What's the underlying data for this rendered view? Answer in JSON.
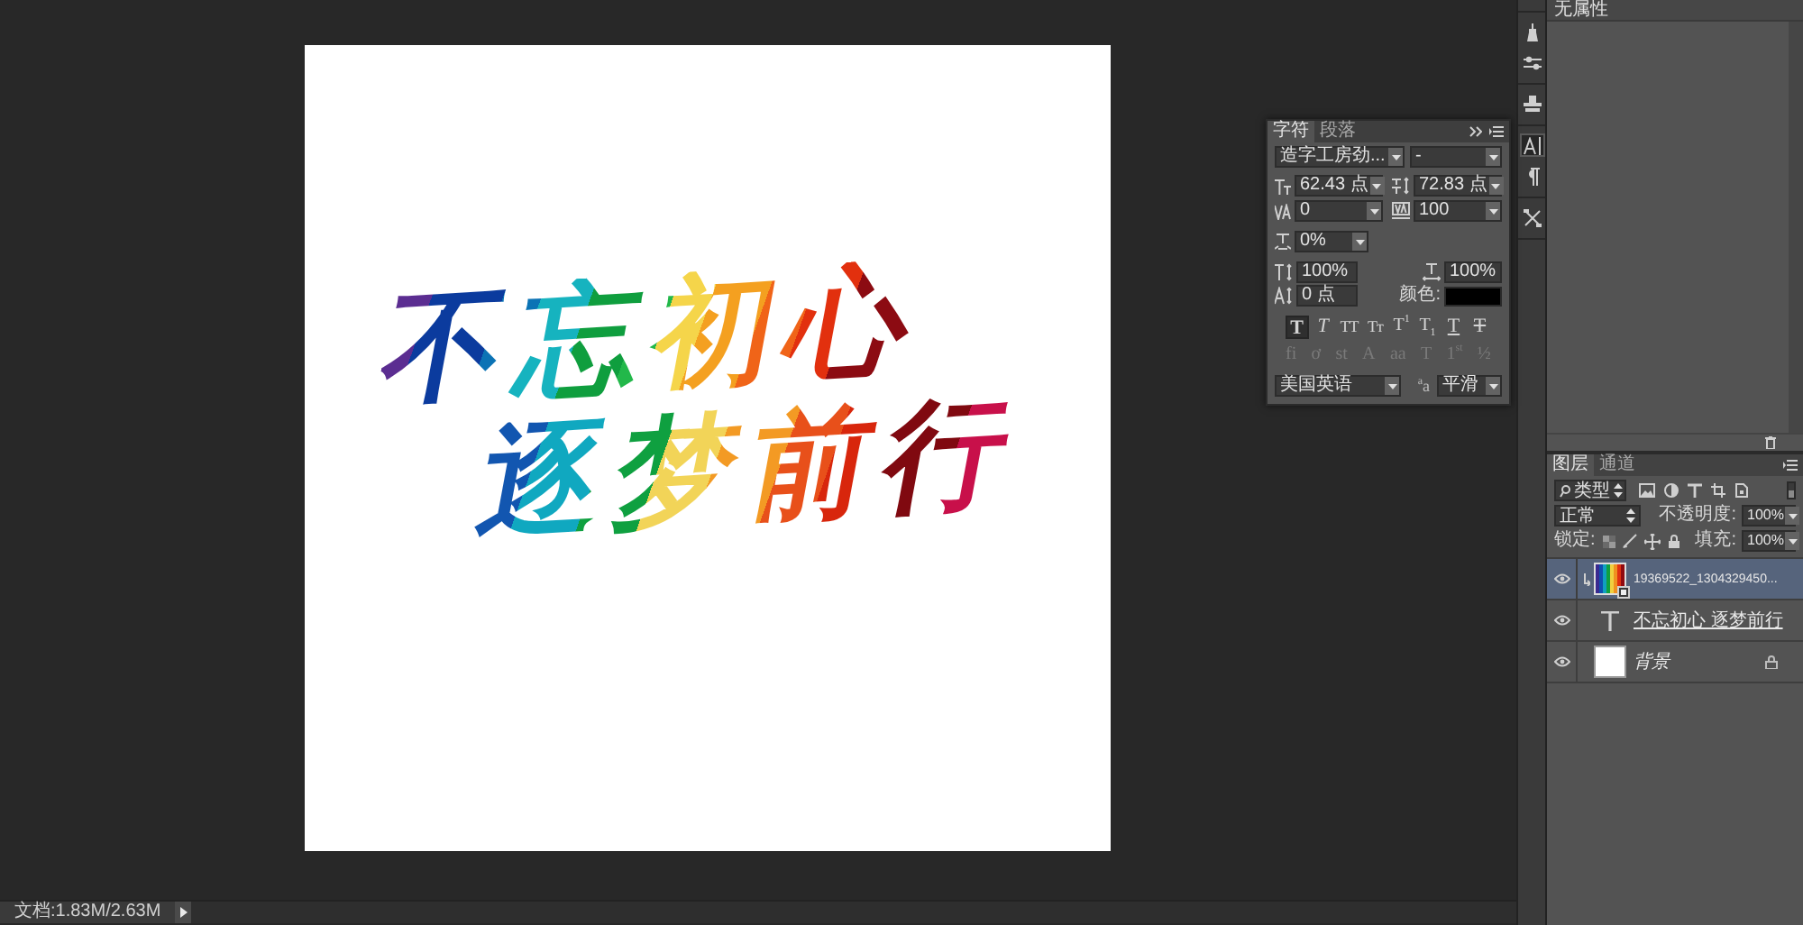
{
  "canvas": {
    "lines": [
      "不忘初心",
      "逐梦前行"
    ]
  },
  "character_panel": {
    "tabs": [
      {
        "label": "字符",
        "selected": true
      },
      {
        "label": "段落",
        "selected": false
      }
    ],
    "font_family": "造字工房劲...",
    "font_style": "-",
    "font_size": "62.43 点",
    "leading": "72.83 点",
    "kerning": "0",
    "tracking": "100",
    "tsume": "0%",
    "vertical_scale": "100%",
    "horizontal_scale": "100%",
    "baseline_shift": "0 点",
    "color_swatch": {
      "label": "颜色:",
      "color": "#000000"
    },
    "style_buttons": [
      {
        "kind": "faux_bold",
        "label": "T",
        "selected": true
      },
      {
        "kind": "faux_italic",
        "label": "T",
        "selected": false
      },
      {
        "kind": "all_caps",
        "label": "TT",
        "selected": false
      },
      {
        "kind": "small_caps",
        "label": "Tт",
        "selected": false
      },
      {
        "kind": "superscript",
        "label": "T$^{1}$",
        "selected": false
      },
      {
        "kind": "subscript",
        "label": "T$_{1}$",
        "selected": false
      },
      {
        "kind": "underline",
        "label": "T",
        "selected": false
      },
      {
        "kind": "strikethrough",
        "label": "T",
        "selected": false
      }
    ],
    "opentype_buttons": [
      {
        "label": "fi",
        "disabled": true
      },
      {
        "label": "ơ",
        "disabled": true
      },
      {
        "label": "st",
        "disabled": true
      },
      {
        "label": "A",
        "disabled": true
      },
      {
        "label": "aa",
        "disabled": true
      },
      {
        "label": "T",
        "disabled": true
      },
      {
        "label": "1$^{st}$",
        "disabled": true
      },
      {
        "label": "½",
        "disabled": true
      }
    ],
    "language": "美国英语",
    "antialias_symbol": "$^{a}$a",
    "antialias": "平滑"
  },
  "dock_groups": [
    {
      "icons": [
        {
          "kind": "brush",
          "selected": false
        },
        {
          "kind": "sliders",
          "selected": false
        }
      ]
    },
    {
      "icons": [
        {
          "kind": "stamp",
          "selected": false
        }
      ]
    },
    {
      "icons": [
        {
          "kind": "type",
          "selected": true
        },
        {
          "kind": "paragraph",
          "selected": false
        }
      ]
    },
    {
      "icons": [
        {
          "kind": "tools",
          "selected": false
        }
      ]
    }
  ],
  "properties_panel": {
    "title": "无属性"
  },
  "layers_panel": {
    "tabs": [
      {
        "label": "图层",
        "selected": true
      },
      {
        "label": "通道",
        "selected": false
      }
    ],
    "filter": "类型",
    "filter_enabled": false,
    "blend_mode": "正常",
    "opacity_label": "不透明度:",
    "opacity": "100%",
    "lock_label": "锁定:",
    "fill_label": "填充:",
    "fill": "100%",
    "layers": [
      {
        "kind": "smart_object",
        "name": "19369522_1304329450...",
        "visible": true,
        "selected": true,
        "clipped": true,
        "clip_base": false,
        "locked": false
      },
      {
        "kind": "text",
        "name": "不忘初心 逐梦前行",
        "visible": true,
        "selected": false,
        "clipped": false,
        "clip_base": true,
        "locked": false
      },
      {
        "kind": "background",
        "name": "背景",
        "visible": true,
        "selected": false,
        "clipped": false,
        "clip_base": false,
        "locked": true
      }
    ]
  },
  "status_bar": {
    "doc_info": "文档:1.83M/2.63M"
  }
}
